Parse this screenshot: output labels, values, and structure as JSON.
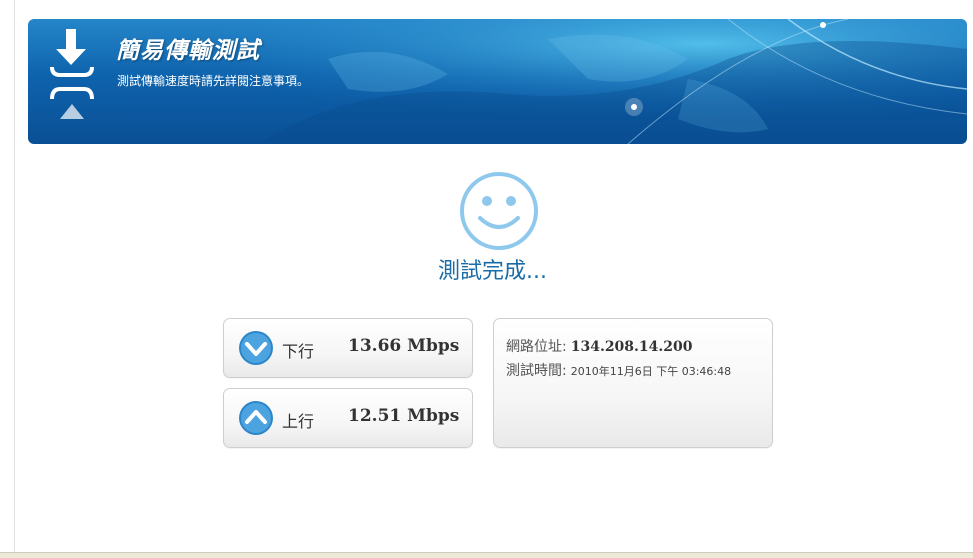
{
  "banner": {
    "title": "簡易傳輸測試",
    "subtitle": "測試傳輸速度時請先詳閱注意事項。"
  },
  "result": {
    "status": "測試完成..."
  },
  "download": {
    "label": "下行",
    "speed": "13.66 Mbps"
  },
  "upload": {
    "label": "上行",
    "speed": "12.51 Mbps"
  },
  "info": {
    "ip_label": "網路位址:",
    "ip_value": "134.208.14.200",
    "time_label": "測試時間:",
    "time_value": "2010年11月6日 下午 03:46:48"
  },
  "icons": {
    "banner": "transfer-arrows-icon",
    "status": "smiley-face-icon",
    "download": "chevron-down-circle-icon",
    "upload": "chevron-up-circle-icon"
  },
  "colors": {
    "banner_blue": "#0e63ad",
    "status_text": "#1a6ca6",
    "icon_blue": "#3a8fd0"
  }
}
